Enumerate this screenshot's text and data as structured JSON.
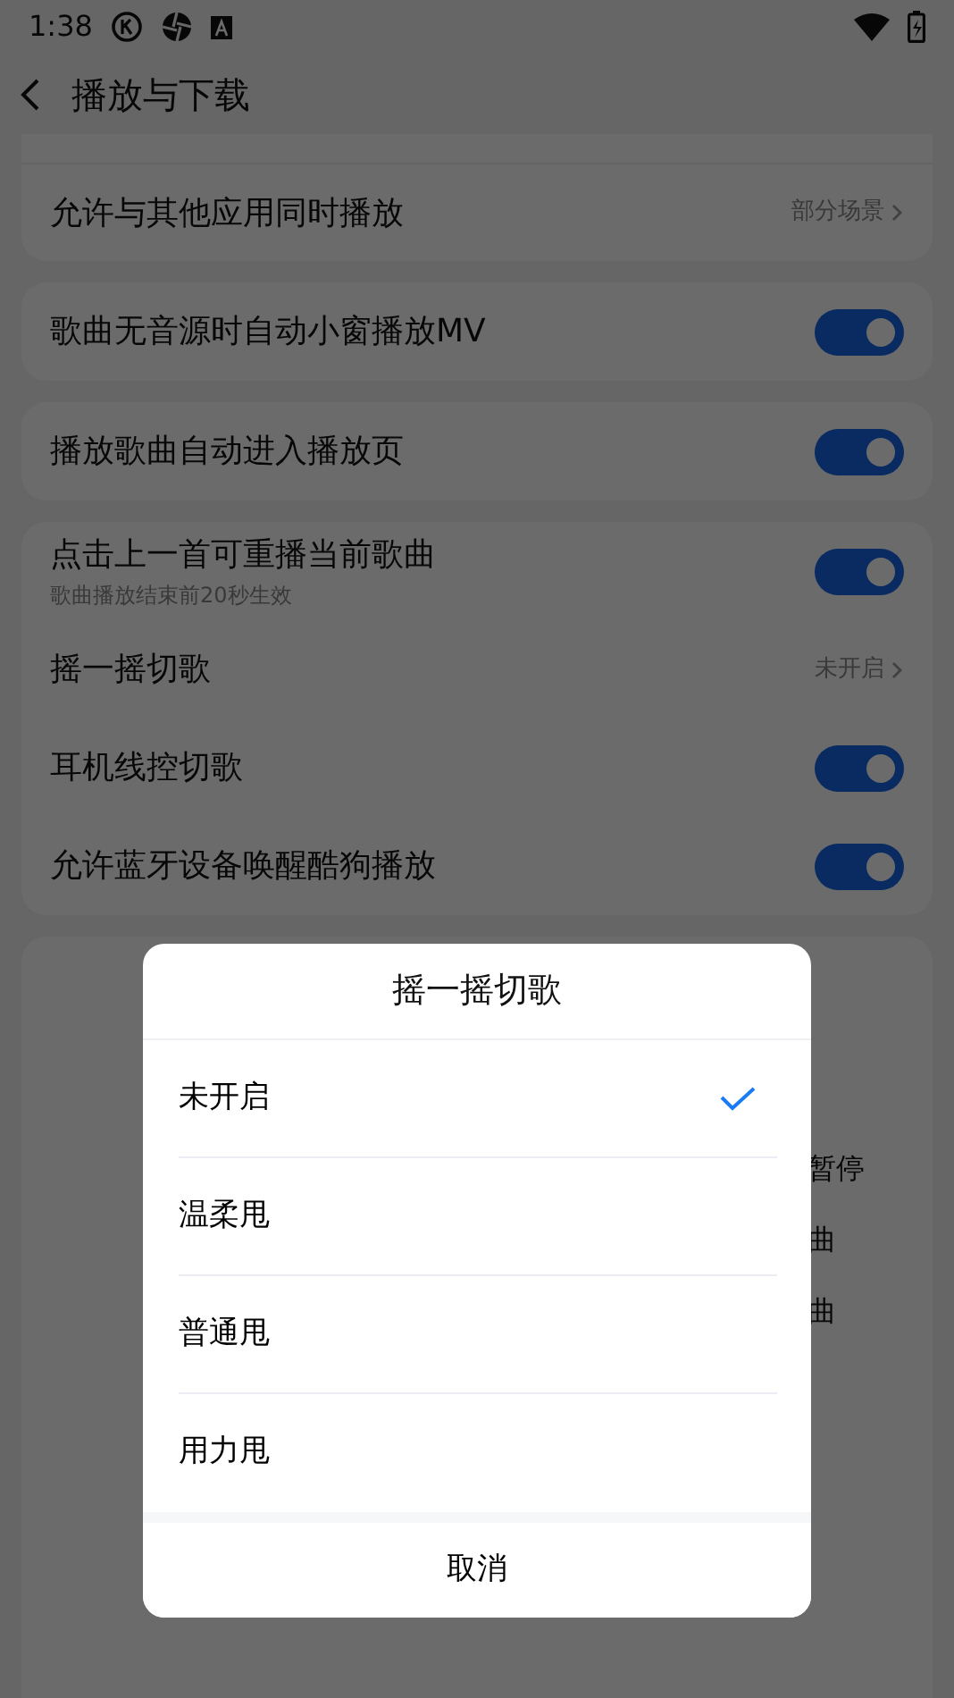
{
  "status_bar": {
    "time": "1:38"
  },
  "header": {
    "title": "播放与下载"
  },
  "groups": [
    {
      "rows": [
        {
          "kind": "value",
          "label": "允许与其他应用同时播放",
          "value": "部分场景"
        }
      ]
    },
    {
      "rows": [
        {
          "kind": "toggle",
          "label": "歌曲无音源时自动小窗播放MV",
          "on": true
        }
      ]
    },
    {
      "rows": [
        {
          "kind": "toggle",
          "label": "播放歌曲自动进入播放页",
          "on": true
        }
      ]
    },
    {
      "rows": [
        {
          "kind": "toggle",
          "label": "点击上一首可重播当前歌曲",
          "sub": "歌曲播放结束前20秒生效",
          "on": true
        },
        {
          "kind": "value",
          "label": "摇一摇切歌",
          "value": "未开启"
        },
        {
          "kind": "toggle",
          "label": "耳机线控切歌",
          "on": true
        },
        {
          "kind": "toggle",
          "label": "允许蓝牙设备唤醒酷狗播放",
          "on": true
        }
      ]
    }
  ],
  "hidden_group_fragments": [
    "暂停",
    "曲",
    "曲"
  ],
  "dialog": {
    "title": "摇一摇切歌",
    "options": [
      {
        "label": "未开启",
        "selected": true
      },
      {
        "label": "温柔甩",
        "selected": false
      },
      {
        "label": "普通甩",
        "selected": false
      },
      {
        "label": "用力甩",
        "selected": false
      }
    ],
    "cancel": "取消"
  }
}
